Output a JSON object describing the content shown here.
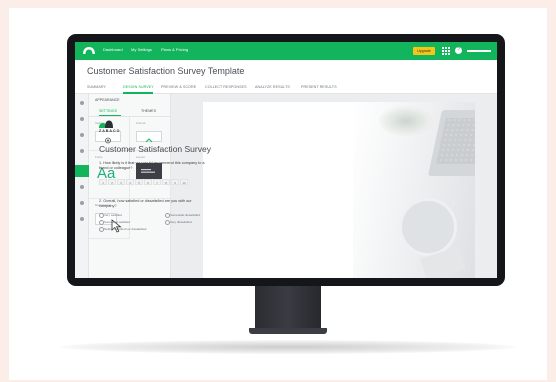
{
  "topbar": {
    "nav": [
      "Dashboard",
      "My Settings",
      "Plans & Pricing"
    ],
    "upgrade_label": "Upgrade",
    "help_glyph": "?"
  },
  "document": {
    "title": "Customer Satisfaction Survey Template"
  },
  "tabs": [
    "SUMMARY",
    "DESIGN SURVEY",
    "PREVIEW & SCORE",
    "COLLECT RESPONSES",
    "ANALYZE RESULTS",
    "PRESENT RESULTS"
  ],
  "active_tab": "DESIGN SURVEY",
  "panel": {
    "heading": "APPEARANCE",
    "subtabs": [
      "SETTINGS",
      "THEMES"
    ],
    "cells": [
      "Settings",
      "Format",
      "Fonts",
      "Layout",
      "Background"
    ],
    "font_sample": "Aa"
  },
  "survey": {
    "brand": "ZABACO",
    "title": "Customer Satisfaction Survey",
    "q1": "1. How likely is it that you would recommend this company to a friend or colleague?",
    "scale": [
      "1",
      "2",
      "3",
      "4",
      "5",
      "6",
      "7",
      "8",
      "9",
      "10"
    ],
    "q2": "2. Overall, how satisfied or dissatisfied are you with our company?",
    "options": [
      "Very satisfied",
      "Somewhat satisfied",
      "Neither satisfied nor dissatisfied",
      "Somewhat dissatisfied",
      "Very dissatisfied"
    ]
  },
  "colors": {
    "brand_green": "#12b55c",
    "upgrade_yellow": "#f5c518",
    "background_peach": "#fbeee8"
  }
}
